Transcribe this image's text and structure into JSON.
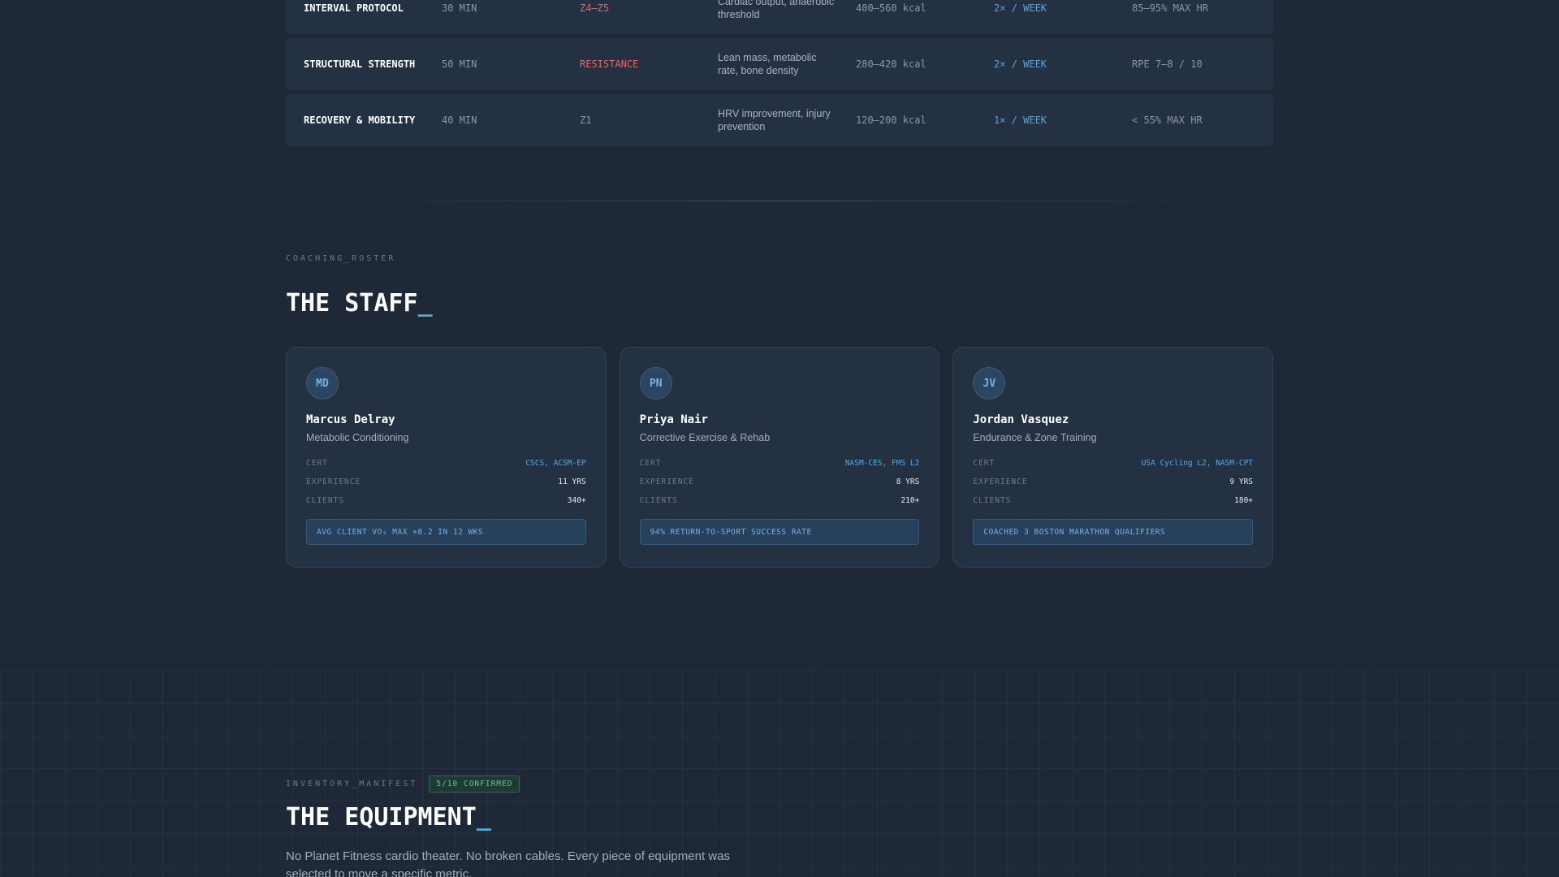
{
  "protocols": [
    {
      "name": "INTERVAL PROTOCOL",
      "duration": "30 MIN",
      "zone": "Z4–Z5",
      "zone_color": "red",
      "benefit": "Cardiac output, anaerobic threshold",
      "calories": "400–560 kcal",
      "frequency": "2× / WEEK",
      "intensity": "85–95% MAX HR"
    },
    {
      "name": "STRUCTURAL STRENGTH",
      "duration": "50 MIN",
      "zone": "RESISTANCE",
      "zone_color": "red",
      "benefit": "Lean mass, metabolic rate, bone density",
      "calories": "280–420 kcal",
      "frequency": "2× / WEEK",
      "intensity": "RPE 7–8 / 10"
    },
    {
      "name": "RECOVERY & MOBILITY",
      "duration": "40 MIN",
      "zone": "Z1",
      "zone_color": "blue",
      "benefit": "HRV improvement, injury prevention",
      "calories": "120–200 kcal",
      "frequency": "1× / WEEK",
      "intensity": "< 55% MAX HR"
    }
  ],
  "staff": {
    "eyebrow": "COACHING_ROSTER",
    "title": "THE STAFF",
    "cursor": "_",
    "stat_labels": {
      "cert": "CERT",
      "experience": "EXPERIENCE",
      "clients": "CLIENTS"
    },
    "coaches": [
      {
        "initials": "MD",
        "name": "Marcus Delray",
        "specialty": "Metabolic Conditioning",
        "cert": "CSCS, ACSM-EP",
        "experience": "11 YRS",
        "clients": "340+",
        "highlight": "AVG CLIENT VO₂ MAX +8.2 IN 12 WKS"
      },
      {
        "initials": "PN",
        "name": "Priya Nair",
        "specialty": "Corrective Exercise & Rehab",
        "cert": "NASM-CES, FMS L2",
        "experience": "8 YRS",
        "clients": "210+",
        "highlight": "94% RETURN-TO-SPORT SUCCESS RATE"
      },
      {
        "initials": "JV",
        "name": "Jordan Vasquez",
        "specialty": "Endurance & Zone Training",
        "cert": "USA Cycling L2, NASM-CPT",
        "experience": "9 YRS",
        "clients": "180+",
        "highlight": "COACHED 3 BOSTON MARATHON QUALIFIERS"
      }
    ]
  },
  "equipment": {
    "eyebrow": "INVENTORY_MANIFEST",
    "badge": "5/10 CONFIRMED",
    "title": "THE EQUIPMENT",
    "cursor": "_",
    "description": "No Planet Fitness cardio theater. No broken cables. Every piece of equipment was selected to move a specific metric."
  },
  "colors": {
    "background": "#1e2837",
    "card": "#243143",
    "accent_blue": "#58a6e0",
    "accent_red": "#e8646a",
    "accent_green": "#5ec98e"
  }
}
